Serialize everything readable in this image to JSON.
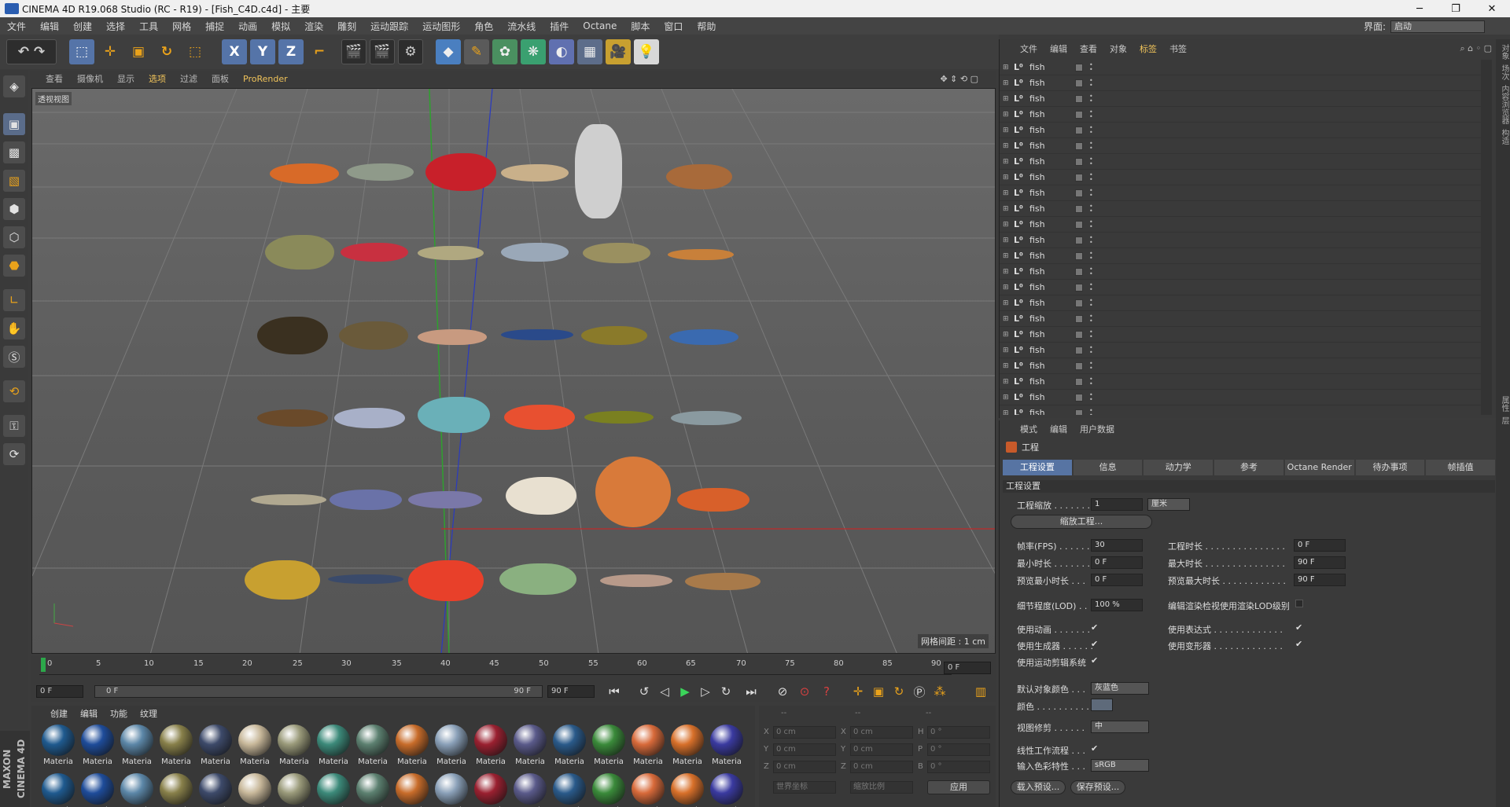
{
  "window": {
    "title": "CINEMA 4D R19.068 Studio (RC - R19) - [Fish_C4D.c4d] - 主要",
    "min": "─",
    "max": "❐",
    "close": "✕"
  },
  "menu": [
    "文件",
    "编辑",
    "创建",
    "选择",
    "工具",
    "网格",
    "捕捉",
    "动画",
    "模拟",
    "渲染",
    "雕刻",
    "运动跟踪",
    "运动图形",
    "角色",
    "流水线",
    "插件",
    "Octane",
    "脚本",
    "窗口",
    "帮助"
  ],
  "interface": {
    "label": "界面:",
    "value": "启动"
  },
  "toolbar": {
    "x": "X",
    "y": "Y",
    "z": "Z"
  },
  "viewport_menu": {
    "items": [
      "查看",
      "摄像机",
      "显示",
      "选项",
      "过滤",
      "面板"
    ],
    "prorender": "ProRender",
    "active_index": 3
  },
  "viewport": {
    "label": "透视视图",
    "grid_info": "网格间距 : 1 cm"
  },
  "timeline": {
    "ticks": [
      "0",
      "5",
      "10",
      "15",
      "20",
      "25",
      "30",
      "35",
      "40",
      "45",
      "50",
      "55",
      "60",
      "65",
      "70",
      "75",
      "80",
      "85",
      "90"
    ],
    "end_frame": "0 F",
    "start_field": "0 F",
    "current_field": "0 F",
    "range_end": "90 F",
    "max_field": "90 F"
  },
  "materials": {
    "menu": [
      "创建",
      "编辑",
      "功能",
      "纹理"
    ],
    "name": "Materia",
    "colors": [
      "#1f5a8f",
      "#1e4c9a",
      "#5c87a8",
      "#88804a",
      "#3d4a6a",
      "#c8b89a",
      "#9a9a7a",
      "#3c8a7a",
      "#5c8070",
      "#c86c2a",
      "#8aa0b8",
      "#9a2030",
      "#5a5a8a",
      "#2a5a8a",
      "#3a8a3a",
      "#d86a3a",
      "#d8702a",
      "#3a3aa0"
    ]
  },
  "coords": {
    "headers": [
      "--",
      "--",
      "--"
    ],
    "rows": [
      {
        "a": "X",
        "av": "0 cm",
        "b": "X",
        "bv": "0 cm",
        "c": "H",
        "cv": "0 °"
      },
      {
        "a": "Y",
        "av": "0 cm",
        "b": "Y",
        "bv": "0 cm",
        "c": "P",
        "cv": "0 °"
      },
      {
        "a": "Z",
        "av": "0 cm",
        "b": "Z",
        "bv": "0 cm",
        "c": "B",
        "cv": "0 °"
      }
    ],
    "world": "世界坐标",
    "scale": "缩放比例",
    "apply": "应用"
  },
  "objects": {
    "menu": [
      "文件",
      "编辑",
      "查看",
      "对象",
      "标签",
      "书签"
    ],
    "active_index": 4,
    "items": [
      "fish",
      "fish",
      "fish",
      "fish",
      "fish",
      "fish",
      "fish",
      "fish",
      "fish",
      "fish",
      "fish",
      "fish",
      "fish",
      "fish",
      "fish",
      "fish",
      "fish",
      "fish",
      "fish",
      "fish",
      "fish",
      "fish",
      "fish"
    ]
  },
  "attributes": {
    "menu": [
      "模式",
      "编辑",
      "用户数据"
    ],
    "title": "工程",
    "tabs": [
      "工程设置",
      "信息",
      "动力学",
      "参考",
      "Octane Render",
      "待办事项",
      "帧插值"
    ],
    "section": "工程设置",
    "scale_label": "工程缩放 . . . . . . .",
    "scale_value": "1",
    "scale_unit": "厘米",
    "scale_btn": "缩放工程...",
    "fps_label": "帧率(FPS) . . . . . .",
    "fps": "30",
    "duration_label": "工程时长 . . . . . . . . . . . . . . .",
    "duration": "0 F",
    "min_label": "最小时长 . . . . . . .",
    "min": "0 F",
    "max_label": "最大时长 . . . . . . . . . . . . . . .",
    "max": "90 F",
    "pmin_label": "预览最小时长 . . .",
    "pmin": "0 F",
    "pmax_label": "预览最大时长 . . . . . . . . . . . .",
    "pmax": "90 F",
    "lod_label": "细节程度(LOD) . . .",
    "lod": "100 %",
    "lod2_label": "编辑渲染检视使用渲染LOD级别",
    "anim_label": "使用动画 . . . . . . .",
    "expr_label": "使用表达式 . . . . . . . . . . . . .",
    "gen_label": "使用生成器 . . . . . .",
    "deform_label": "使用变形器 . . . . . . . . . . . . .",
    "motion_label": "使用运动剪辑系统",
    "objcolor_label": "默认对象颜色 . . .",
    "objcolor": "灰蓝色",
    "color_label": "颜色 . . . . . . . . . . .",
    "clip_label": "视图修剪 . . . . . .",
    "clip": "中",
    "linear_label": "线性工作流程 . . .",
    "colorprofile_label": "输入色彩特性 . . .",
    "colorprofile": "sRGB",
    "load_btn": "载入预设...",
    "save_btn": "保存预设...",
    "check": "✔"
  },
  "right_strip": [
    "对象",
    "场次",
    "内容浏览器",
    "构造",
    "属性",
    "层"
  ],
  "brand": "MAXON CINEMA 4D"
}
